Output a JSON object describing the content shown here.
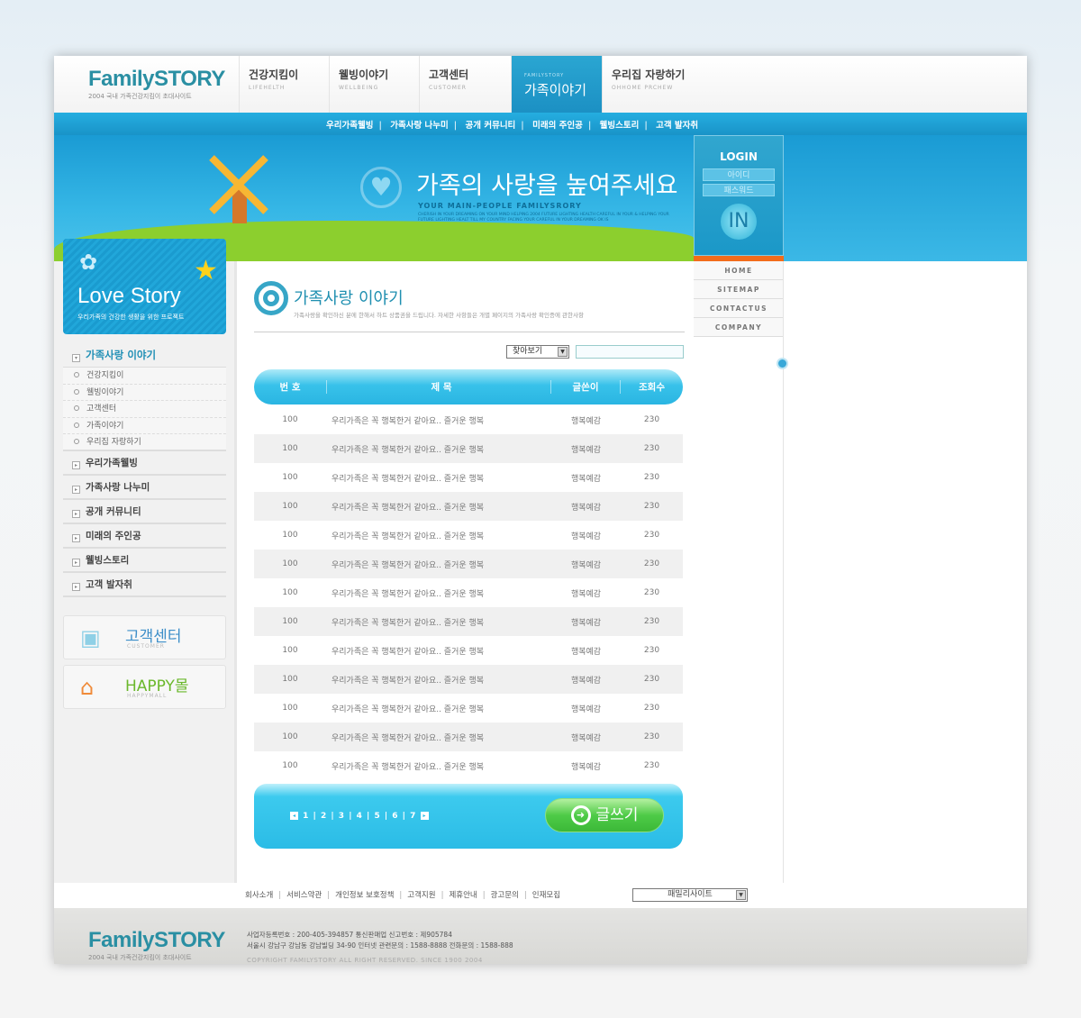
{
  "header": {
    "logo": "FamilySTORY",
    "logo_tagline": "2004 국내 가족건강지킴이 초대사이트",
    "tabs": [
      {
        "label": "건강지킴이",
        "sub": "LIFEHELTH"
      },
      {
        "label": "웰빙이야기",
        "sub": "WELLBEING"
      },
      {
        "label": "고객센터",
        "sub": "CUSTOMER"
      },
      {
        "label": "가족이야기",
        "sub": "FAMILYSTORY",
        "active": true
      },
      {
        "label": "우리집 자랑하기",
        "sub": "OHHOME PRCHEW"
      }
    ]
  },
  "subnav": [
    "우리가족웰빙",
    "가족사랑 나누미",
    "공개 커뮤니티",
    "미래의 주인공",
    "웰빙스토리",
    "고객 발자취"
  ],
  "banner": {
    "title": "가족의 사랑을 높여주세요",
    "subtitle": "YOUR MAIN-PEOPLE FAMILYSRORY",
    "small": "CHERISH IN YOUR DREAMING ON YOUR MIND HELPING 2004 FUTURE LIGHTING HEALTH CAREFUL IN YOUR & HELPING YOUR FUTURE LIGHTING HEALT TILL MY COUNTRY FACING YOUR CAREFUL IN YOUR DREAMING OK IS"
  },
  "login": {
    "title": "LOGIN",
    "id_placeholder": "아이디",
    "pw_placeholder": "패스워드",
    "button": "IN"
  },
  "quick_links": [
    "HOME",
    "SITEMAP",
    "CONTACTUS",
    "COMPANY"
  ],
  "sidebar": {
    "promo": {
      "title": "Love Story",
      "subtitle": "우리가족의 건강한 생활을 위한 프로젝트"
    },
    "section": "가족사랑 이야기",
    "sub_items": [
      "건강지킴이",
      "웰빙이야기",
      "고객센터",
      "가족이야기",
      "우리집 자랑하기"
    ],
    "items": [
      "우리가족웰빙",
      "가족사랑 나누미",
      "공개 커뮤니티",
      "미래의 주인공",
      "웰빙스토리",
      "고객 발자취"
    ],
    "cards": [
      {
        "label": "고객센터",
        "sub": "CUSTOMER"
      },
      {
        "label": "HAPPY몰",
        "sub": "HAPPYMALL"
      }
    ]
  },
  "main": {
    "title": "가족사랑 이야기",
    "description": "가족사랑을 확인하신 분에 한해서 하트 상품권을 드립니다. 자세한 사항들은 개별 페이지의 가족사랑 확인증에 관한사항",
    "search_select": "찾아보기",
    "search_value": "",
    "columns": [
      "번 호",
      "제 목",
      "글쓴이",
      "조회수"
    ],
    "rows": [
      [
        "100",
        "우리가족은 꼭 행복한거 같아요.. 즐거운 행복",
        "행복예감",
        "230"
      ],
      [
        "100",
        "우리가족은 꼭 행복한거 같아요.. 즐거운 행복",
        "행복예감",
        "230"
      ],
      [
        "100",
        "우리가족은 꼭 행복한거 같아요.. 즐거운 행복",
        "행복예감",
        "230"
      ],
      [
        "100",
        "우리가족은 꼭 행복한거 같아요.. 즐거운 행복",
        "행복예감",
        "230"
      ],
      [
        "100",
        "우리가족은 꼭 행복한거 같아요.. 즐거운 행복",
        "행복예감",
        "230"
      ],
      [
        "100",
        "우리가족은 꼭 행복한거 같아요.. 즐거운 행복",
        "행복예감",
        "230"
      ],
      [
        "100",
        "우리가족은 꼭 행복한거 같아요.. 즐거운 행복",
        "행복예감",
        "230"
      ],
      [
        "100",
        "우리가족은 꼭 행복한거 같아요.. 즐거운 행복",
        "행복예감",
        "230"
      ],
      [
        "100",
        "우리가족은 꼭 행복한거 같아요.. 즐거운 행복",
        "행복예감",
        "230"
      ],
      [
        "100",
        "우리가족은 꼭 행복한거 같아요.. 즐거운 행복",
        "행복예감",
        "230"
      ],
      [
        "100",
        "우리가족은 꼭 행복한거 같아요.. 즐거운 행복",
        "행복예감",
        "230"
      ],
      [
        "100",
        "우리가족은 꼭 행복한거 같아요.. 즐거운 행복",
        "행복예감",
        "230"
      ],
      [
        "100",
        "우리가족은 꼭 행복한거 같아요.. 즐거운 행복",
        "행복예감",
        "230"
      ]
    ],
    "pages": [
      "1",
      "2",
      "3",
      "4",
      "5",
      "6",
      "7"
    ],
    "write_button": "글쓰기"
  },
  "footer": {
    "links": [
      "회사소개",
      "서비스약관",
      "개인정보 보호정책",
      "고객지원",
      "제휴안내",
      "광고문의",
      "인재모집"
    ],
    "family_site": "패밀리사이트",
    "info_line1": "사업자등록번호 : 200-405-394857  통신판매업 신고번호 : 제905784",
    "info_line2": "서울시 강남구 강남동 강남빌딩 34-90  인터넷 관련문의 : 1588-8888 전화문의 : 1588-888",
    "copyright": "COPYRIGHT FAMILYSTORY ALL RIGHT RESERVED. SINCE 1900 2004"
  },
  "colors": {
    "primary": "#1f9fd4",
    "accent_green": "#4ecb47",
    "accent_orange": "#f26c1b"
  }
}
